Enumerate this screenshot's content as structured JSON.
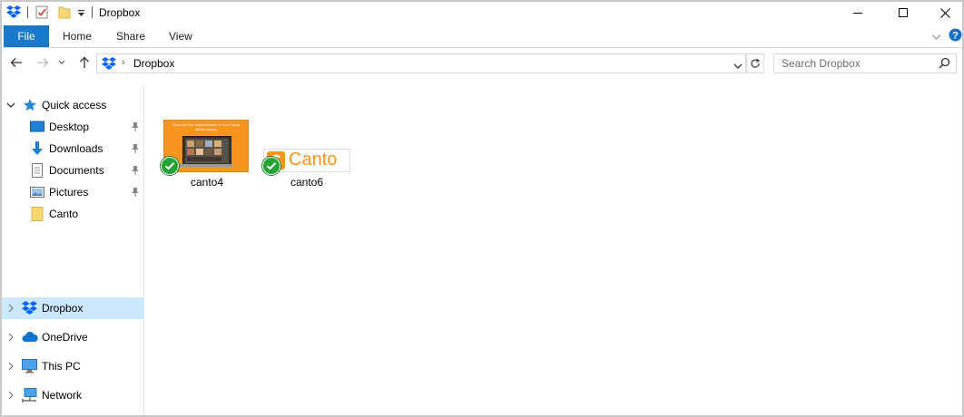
{
  "window": {
    "title": "Dropbox"
  },
  "ribbon": {
    "tabs": [
      {
        "label": "File"
      },
      {
        "label": "Home"
      },
      {
        "label": "Share"
      },
      {
        "label": "View"
      }
    ]
  },
  "address": {
    "path": "Dropbox"
  },
  "search": {
    "placeholder": "Search Dropbox"
  },
  "nav": {
    "quick_access": "Quick access",
    "items": [
      {
        "label": "Desktop",
        "pinned": true
      },
      {
        "label": "Downloads",
        "pinned": true
      },
      {
        "label": "Documents",
        "pinned": true
      },
      {
        "label": "Pictures",
        "pinned": true
      },
      {
        "label": "Canto",
        "pinned": false
      }
    ],
    "locations": [
      {
        "label": "Dropbox",
        "selected": true
      },
      {
        "label": "OneDrive"
      },
      {
        "label": "This PC"
      },
      {
        "label": "Network"
      }
    ]
  },
  "files": [
    {
      "name": "canto4",
      "thumb_text": "Store All Your Brand Assets in Your Canto Media Library",
      "status": "synced"
    },
    {
      "name": "canto6",
      "thumb_text": "Canto",
      "status": "synced"
    }
  ],
  "colors": {
    "accent": "#1979ca",
    "selected_bg": "#cce8ff",
    "orange": "#f7941d",
    "synced": "#22a332"
  }
}
